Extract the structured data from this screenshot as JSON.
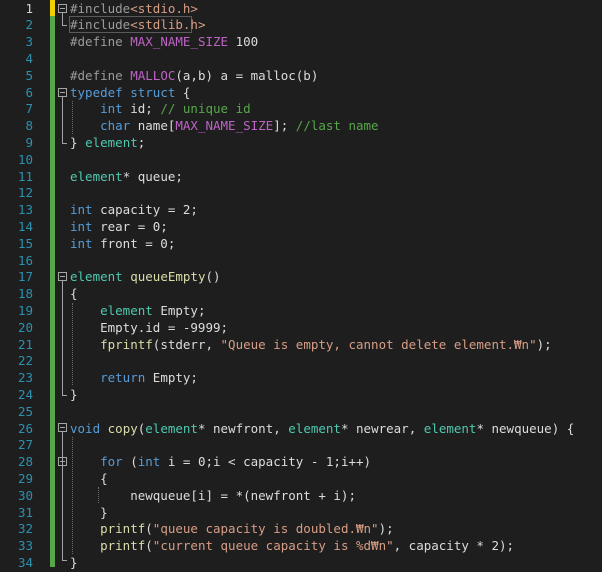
{
  "editor": {
    "line_numbers": [
      "1",
      "2",
      "3",
      "4",
      "5",
      "6",
      "7",
      "8",
      "9",
      "10",
      "11",
      "12",
      "13",
      "14",
      "15",
      "16",
      "17",
      "18",
      "19",
      "20",
      "21",
      "22",
      "23",
      "24",
      "25",
      "26",
      "27",
      "28",
      "29",
      "30",
      "31",
      "32",
      "33",
      "34"
    ],
    "current_line": "1",
    "lines": [
      [
        [
          "#include",
          "pp"
        ],
        [
          "<stdio.h>",
          "str"
        ]
      ],
      [
        [
          "#include",
          "pp"
        ],
        [
          "<stdlib.h>",
          "str"
        ]
      ],
      [
        [
          "#define ",
          "pp"
        ],
        [
          "MAX_NAME_SIZE",
          "mac"
        ],
        [
          " 100",
          "id"
        ]
      ],
      [],
      [
        [
          "#define ",
          "pp"
        ],
        [
          "MALLOC",
          "mac"
        ],
        [
          "(a,b) a = malloc(b)",
          "id"
        ]
      ],
      [
        [
          "typedef",
          "kw"
        ],
        [
          " ",
          "id"
        ],
        [
          "struct",
          "kw"
        ],
        [
          " {",
          "id"
        ]
      ],
      [
        [
          "    ",
          "id"
        ],
        [
          "int",
          "kw"
        ],
        [
          " id; ",
          "id"
        ],
        [
          "// unique id",
          "cm"
        ]
      ],
      [
        [
          "    ",
          "id"
        ],
        [
          "char",
          "kw"
        ],
        [
          " name[",
          "id"
        ],
        [
          "MAX_NAME_SIZE",
          "mac"
        ],
        [
          "]; ",
          "id"
        ],
        [
          "//last name",
          "cm"
        ]
      ],
      [
        [
          "} ",
          "id"
        ],
        [
          "element",
          "tp"
        ],
        [
          ";",
          "id"
        ]
      ],
      [],
      [
        [
          "element",
          "tp"
        ],
        [
          "* queue;",
          "id"
        ]
      ],
      [],
      [
        [
          "int",
          "kw"
        ],
        [
          " capacity = 2;",
          "id"
        ]
      ],
      [
        [
          "int",
          "kw"
        ],
        [
          " rear = 0;",
          "id"
        ]
      ],
      [
        [
          "int",
          "kw"
        ],
        [
          " front = 0;",
          "id"
        ]
      ],
      [],
      [
        [
          "element",
          "tp"
        ],
        [
          " ",
          "id"
        ],
        [
          "queueEmpty",
          "fn"
        ],
        [
          "()",
          "id"
        ]
      ],
      [
        [
          "{",
          "id"
        ]
      ],
      [
        [
          "    ",
          "id"
        ],
        [
          "element",
          "tp"
        ],
        [
          " Empty;",
          "id"
        ]
      ],
      [
        [
          "    Empty.id = -9999;",
          "id"
        ]
      ],
      [
        [
          "    ",
          "id"
        ],
        [
          "fprintf",
          "fn"
        ],
        [
          "(stderr, ",
          "id"
        ],
        [
          "\"Queue is empty, cannot delete element.₩n\"",
          "str"
        ],
        [
          ");",
          "id"
        ]
      ],
      [],
      [
        [
          "    ",
          "id"
        ],
        [
          "return",
          "kw"
        ],
        [
          " Empty;",
          "id"
        ]
      ],
      [
        [
          "}",
          "id"
        ]
      ],
      [],
      [
        [
          "void",
          "kw"
        ],
        [
          " ",
          "id"
        ],
        [
          "copy",
          "fn"
        ],
        [
          "(",
          "id"
        ],
        [
          "element",
          "tp"
        ],
        [
          "* newfront, ",
          "id"
        ],
        [
          "element",
          "tp"
        ],
        [
          "* newrear, ",
          "id"
        ],
        [
          "element",
          "tp"
        ],
        [
          "* newqueue) {",
          "id"
        ]
      ],
      [],
      [
        [
          "    ",
          "id"
        ],
        [
          "for",
          "kw"
        ],
        [
          " (",
          "id"
        ],
        [
          "int",
          "kw"
        ],
        [
          " i = 0;i < capacity - 1;i++)",
          "id"
        ]
      ],
      [
        [
          "    {",
          "id"
        ]
      ],
      [
        [
          "        newqueue[i] = *(newfront + i);",
          "id"
        ]
      ],
      [
        [
          "    }",
          "id"
        ]
      ],
      [
        [
          "    ",
          "id"
        ],
        [
          "printf",
          "fn"
        ],
        [
          "(",
          "id"
        ],
        [
          "\"queue capacity is doubled.₩n\"",
          "str"
        ],
        [
          ");",
          "id"
        ]
      ],
      [
        [
          "    ",
          "id"
        ],
        [
          "printf",
          "fn"
        ],
        [
          "(",
          "id"
        ],
        [
          "\"current queue capacity is %d₩n\"",
          "str"
        ],
        [
          ", capacity * 2);",
          "id"
        ]
      ],
      [
        [
          "}",
          "id"
        ]
      ]
    ]
  }
}
